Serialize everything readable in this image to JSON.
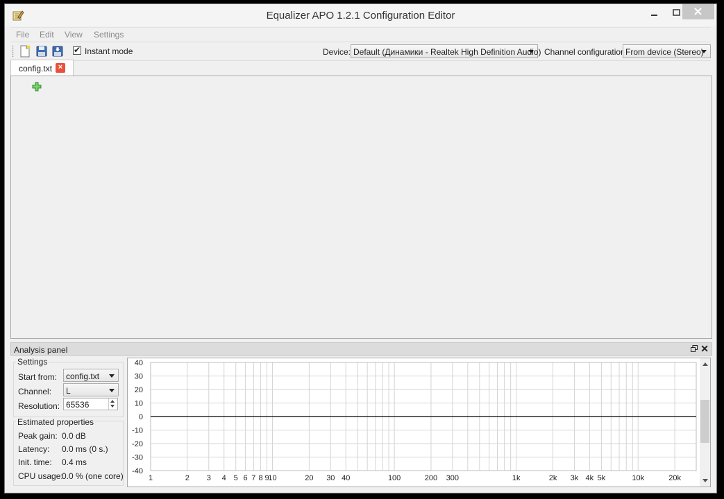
{
  "window": {
    "title": "Equalizer APO 1.2.1 Configuration Editor",
    "minimize_glyph": "_",
    "maximize_glyph": "□",
    "close_glyph": "✕"
  },
  "menu": [
    "File",
    "Edit",
    "View",
    "Settings"
  ],
  "toolbar": {
    "instant_mode_label": "Instant mode",
    "instant_mode_checked": "✔",
    "device_label": "Device:",
    "device_value": "Default (Динамики - Realtek High Definition Audio)",
    "channel_config_label": "Channel configuration:",
    "channel_config_value": "From device (Stereo)"
  },
  "tabs": [
    {
      "label": "config.txt",
      "close_glyph": "×"
    }
  ],
  "analysis_panel": {
    "title": "Analysis panel",
    "close_glyph": "✕",
    "settings": {
      "title": "Settings",
      "start_from_label": "Start from:",
      "start_from_value": "config.txt",
      "channel_label": "Channel:",
      "channel_value": "L",
      "resolution_label": "Resolution:",
      "resolution_value": "65536"
    },
    "estimated": {
      "title": "Estimated properties",
      "peak_gain_label": "Peak gain:",
      "peak_gain_value": "0.0 dB",
      "latency_label": "Latency:",
      "latency_value": "0.0 ms (0 s.)",
      "init_time_label": "Init. time:",
      "init_time_value": "0.4 ms",
      "cpu_usage_label": "CPU usage:",
      "cpu_usage_value": "0.0 % (one core)"
    }
  },
  "graph": {
    "y_ticks": [
      40,
      30,
      20,
      10,
      0,
      -10,
      -20,
      -30,
      -40
    ],
    "ylim": [
      -40,
      40
    ],
    "x_min": 1,
    "x_max": 30000,
    "x_labels": [
      {
        "v": 1,
        "t": "1"
      },
      {
        "v": 2,
        "t": "2"
      },
      {
        "v": 3,
        "t": "3"
      },
      {
        "v": 4,
        "t": "4"
      },
      {
        "v": 5,
        "t": "5"
      },
      {
        "v": 6,
        "t": "6"
      },
      {
        "v": 7,
        "t": "7"
      },
      {
        "v": 8,
        "t": "8"
      },
      {
        "v": 9,
        "t": "9"
      },
      {
        "v": 10,
        "t": "10"
      },
      {
        "v": 20,
        "t": "20"
      },
      {
        "v": 30,
        "t": "30"
      },
      {
        "v": 40,
        "t": "40"
      },
      {
        "v": 100,
        "t": "100"
      },
      {
        "v": 200,
        "t": "200"
      },
      {
        "v": 300,
        "t": "300"
      },
      {
        "v": 1000,
        "t": "1k"
      },
      {
        "v": 2000,
        "t": "2k"
      },
      {
        "v": 3000,
        "t": "3k"
      },
      {
        "v": 4000,
        "t": "4k"
      },
      {
        "v": 5000,
        "t": "5k"
      },
      {
        "v": 10000,
        "t": "10k"
      },
      {
        "v": 20000,
        "t": "20k"
      }
    ],
    "response_db": 0,
    "colors": {
      "grid": "#d4d4d4",
      "line": "#000000"
    }
  }
}
